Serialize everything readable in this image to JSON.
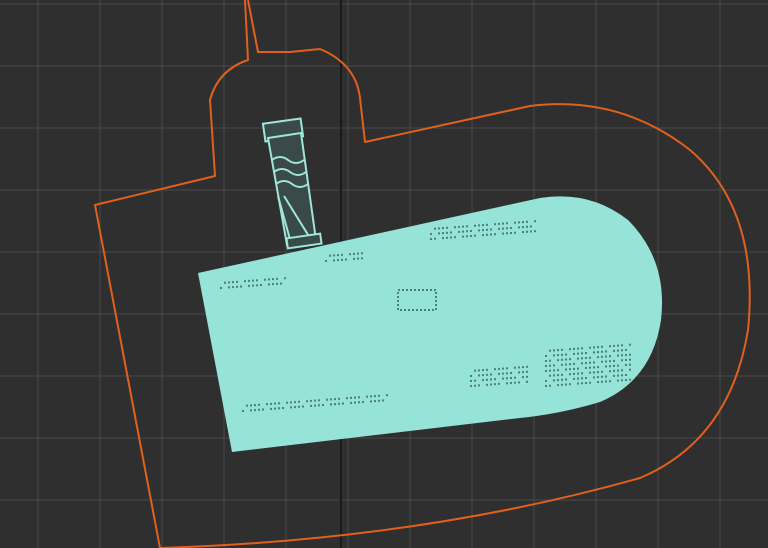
{
  "viewport": {
    "background_color": "#2f2f2f",
    "grid_color": "#4a4a4a",
    "axis_color": "#1a1a1a",
    "grid_visible": true
  },
  "objects": {
    "outline": {
      "stroke_color": "#e0601e"
    },
    "selected_part": {
      "fill_color": "#96e3d8",
      "detail_color": "#4f7f79",
      "selected": true
    },
    "component": {
      "stroke_color": "#9fe6db",
      "fill_color": "#3a4a48"
    }
  }
}
